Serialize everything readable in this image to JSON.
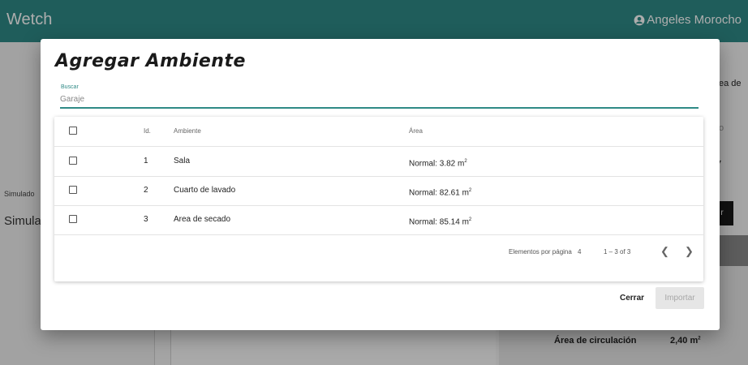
{
  "app": {
    "title": "Wetch",
    "user_name": "Angeles Morocho"
  },
  "background": {
    "sim_small": "Simulado",
    "sim_big": "Simula",
    "right_text": "ea de",
    "right_placeholder": "o",
    "right_button": "r",
    "area_label": "Área de circulación",
    "area_value": "2,40 m",
    "area_sup": "2"
  },
  "dialog": {
    "title": "Agregar Ambiente",
    "search": {
      "label": "Buscar",
      "placeholder": "Garaje"
    },
    "table": {
      "columns": {
        "id": "Id.",
        "ambiente": "Ambiente",
        "area": "Área"
      },
      "rows": [
        {
          "id": "1",
          "ambiente": "Sala",
          "area": "Normal: 3.82 m",
          "unit_sup": "2"
        },
        {
          "id": "2",
          "ambiente": "Cuarto de lavado",
          "area": "Normal: 82.61 m",
          "unit_sup": "2"
        },
        {
          "id": "3",
          "ambiente": "Area de secado",
          "area": "Normal: 85.14 m",
          "unit_sup": "2"
        }
      ]
    },
    "paginator": {
      "label": "Elementos por página",
      "page_size": "4",
      "range": "1 – 3 of 3"
    },
    "buttons": {
      "close": "Cerrar",
      "import": "Importar"
    }
  },
  "colors": {
    "primary": "#2f8a86",
    "overlay": "rgba(0,0,0,0.32)"
  }
}
